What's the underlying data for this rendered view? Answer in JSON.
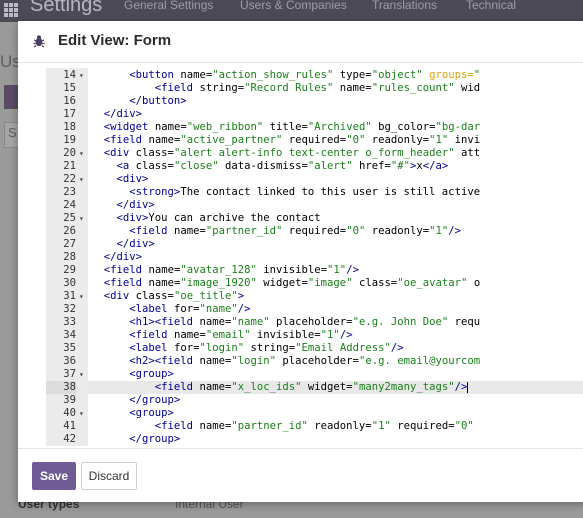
{
  "background": {
    "app_title": "Settings",
    "menu_items": [
      "General Settings",
      "Users & Companies",
      "Translations",
      "Technical"
    ],
    "side_fragment_us": "Us",
    "side_fragment_s": "S",
    "bottom_label": "User types",
    "bottom_option": "Internal User"
  },
  "modal": {
    "title": "Edit View: Form",
    "save_label": "Save",
    "discard_label": "Discard"
  },
  "editor": {
    "active_line": 38,
    "lines": [
      {
        "n": 14,
        "fold": true,
        "indent": 4,
        "html": "<span class=\"tag\">&lt;button</span> <span class=\"attr\">name=</span><span class=\"val\">\"action_show_rules\"</span> <span class=\"attr\">type=</span><span class=\"val\">\"object\"</span> <span class=\"orange\">groups=</span><span class=\"val\">\"</span>"
      },
      {
        "n": 15,
        "fold": false,
        "indent": 6,
        "html": "<span class=\"tag\">&lt;field</span> <span class=\"attr\">string=</span><span class=\"val\">\"Record Rules\"</span> <span class=\"attr\">name=</span><span class=\"val\">\"rules_count\"</span> <span class=\"attr\">wid</span>"
      },
      {
        "n": 16,
        "fold": false,
        "indent": 4,
        "html": "<span class=\"tag\">&lt;/button&gt;</span>"
      },
      {
        "n": 17,
        "fold": false,
        "indent": 2,
        "html": "<span class=\"tag\">&lt;/div&gt;</span>"
      },
      {
        "n": 18,
        "fold": false,
        "indent": 2,
        "html": "<span class=\"tag\">&lt;widget</span> <span class=\"attr\">name=</span><span class=\"val\">\"web_ribbon\"</span> <span class=\"attr\">title=</span><span class=\"val\">\"Archived\"</span> <span class=\"attr\">bg_color=</span><span class=\"val\">\"bg-dar</span>"
      },
      {
        "n": 19,
        "fold": false,
        "indent": 2,
        "html": "<span class=\"tag\">&lt;field</span> <span class=\"attr\">name=</span><span class=\"val\">\"active_partner\"</span> <span class=\"attr\">required=</span><span class=\"val\">\"0\"</span> <span class=\"attr\">readonly=</span><span class=\"val\">\"1\"</span> <span class=\"attr\">invi</span>"
      },
      {
        "n": 20,
        "fold": true,
        "indent": 2,
        "html": "<span class=\"tag\">&lt;div</span> <span class=\"attr\">class=</span><span class=\"val\">\"alert alert-info text-center o_form_header\"</span> <span class=\"attr\">att</span>"
      },
      {
        "n": 21,
        "fold": false,
        "indent": 3,
        "html": "<span class=\"tag\">&lt;a</span> <span class=\"attr\">class=</span><span class=\"val\">\"close\"</span> <span class=\"attr\">data-dismiss=</span><span class=\"val\">\"alert\"</span> <span class=\"attr\">href=</span><span class=\"val\">\"#\"</span><span class=\"tag\">&gt;</span>x<span class=\"tag\">&lt;/a&gt;</span>"
      },
      {
        "n": 22,
        "fold": true,
        "indent": 3,
        "html": "<span class=\"tag\">&lt;div&gt;</span>"
      },
      {
        "n": 23,
        "fold": false,
        "indent": 4,
        "html": "<span class=\"tag\">&lt;strong&gt;</span>The contact linked to this user is still active"
      },
      {
        "n": 24,
        "fold": false,
        "indent": 3,
        "html": "<span class=\"tag\">&lt;/div&gt;</span>"
      },
      {
        "n": 25,
        "fold": true,
        "indent": 3,
        "html": "<span class=\"tag\">&lt;div&gt;</span>You can archive the contact"
      },
      {
        "n": 26,
        "fold": false,
        "indent": 4,
        "html": "<span class=\"tag\">&lt;field</span> <span class=\"attr\">name=</span><span class=\"val\">\"partner_id\"</span> <span class=\"attr\">required=</span><span class=\"val\">\"0\"</span> <span class=\"attr\">readonly=</span><span class=\"val\">\"1\"</span><span class=\"tag\">/&gt;</span>"
      },
      {
        "n": 27,
        "fold": false,
        "indent": 3,
        "html": "<span class=\"tag\">&lt;/div&gt;</span>"
      },
      {
        "n": 28,
        "fold": false,
        "indent": 2,
        "html": "<span class=\"tag\">&lt;/div&gt;</span>"
      },
      {
        "n": 29,
        "fold": false,
        "indent": 2,
        "html": "<span class=\"tag\">&lt;field</span> <span class=\"attr\">name=</span><span class=\"val\">\"avatar_128\"</span> <span class=\"attr\">invisible=</span><span class=\"val\">\"1\"</span><span class=\"tag\">/&gt;</span>"
      },
      {
        "n": 30,
        "fold": false,
        "indent": 2,
        "html": "<span class=\"tag\">&lt;field</span> <span class=\"attr\">name=</span><span class=\"val\">\"image_1920\"</span> <span class=\"attr\">widget=</span><span class=\"val\">\"image\"</span> <span class=\"attr\">class=</span><span class=\"val\">\"oe_avatar\"</span> <span class=\"attr\">o</span>"
      },
      {
        "n": 31,
        "fold": true,
        "indent": 2,
        "html": "<span class=\"tag\">&lt;div</span> <span class=\"attr\">class=</span><span class=\"val\">\"oe_title\"</span><span class=\"tag\">&gt;</span>"
      },
      {
        "n": 32,
        "fold": false,
        "indent": 4,
        "html": "<span class=\"tag\">&lt;label</span> <span class=\"attr\">for=</span><span class=\"val\">\"name\"</span><span class=\"tag\">/&gt;</span>"
      },
      {
        "n": 33,
        "fold": false,
        "indent": 4,
        "html": "<span class=\"tag\">&lt;h1&gt;&lt;field</span> <span class=\"attr\">name=</span><span class=\"val\">\"name\"</span> <span class=\"attr\">placeholder=</span><span class=\"val\">\"e.g. John Doe\"</span> <span class=\"attr\">requ</span>"
      },
      {
        "n": 34,
        "fold": false,
        "indent": 4,
        "html": "<span class=\"tag\">&lt;field</span> <span class=\"attr\">name=</span><span class=\"val\">\"email\"</span> <span class=\"attr\">invisible=</span><span class=\"val\">\"1\"</span><span class=\"tag\">/&gt;</span>"
      },
      {
        "n": 35,
        "fold": false,
        "indent": 4,
        "html": "<span class=\"tag\">&lt;label</span> <span class=\"attr\">for=</span><span class=\"val\">\"login\"</span> <span class=\"attr\">string=</span><span class=\"val\">\"Email Address\"</span><span class=\"tag\">/&gt;</span>"
      },
      {
        "n": 36,
        "fold": false,
        "indent": 4,
        "html": "<span class=\"tag\">&lt;h2&gt;&lt;field</span> <span class=\"attr\">name=</span><span class=\"val\">\"login\"</span> <span class=\"attr\">placeholder=</span><span class=\"val\">\"e.g. email@yourcom</span>"
      },
      {
        "n": 37,
        "fold": true,
        "indent": 4,
        "html": "<span class=\"tag\">&lt;group&gt;</span>"
      },
      {
        "n": 38,
        "fold": false,
        "indent": 6,
        "html": "<span class=\"tag\">&lt;field</span> <span class=\"attr\">name=</span><span class=\"val\">\"x_loc_ids\"</span> <span class=\"attr\">widget=</span><span class=\"val\">\"many2many_tags\"</span><span class=\"tag\">/&gt;</span><span class=\"cursor\"></span>"
      },
      {
        "n": 39,
        "fold": false,
        "indent": 4,
        "html": "<span class=\"tag\">&lt;/group&gt;</span>"
      },
      {
        "n": 40,
        "fold": true,
        "indent": 4,
        "html": "<span class=\"tag\">&lt;group&gt;</span>"
      },
      {
        "n": 41,
        "fold": false,
        "indent": 6,
        "html": "<span class=\"tag\">&lt;field</span> <span class=\"attr\">name=</span><span class=\"val\">\"partner_id\"</span> <span class=\"attr\">readonly=</span><span class=\"val\">\"1\"</span> <span class=\"attr\">required=</span><span class=\"val\">\"0\"</span>"
      },
      {
        "n": 42,
        "fold": false,
        "indent": 4,
        "html": "<span class=\"tag\">&lt;/group&gt;</span>"
      }
    ]
  }
}
